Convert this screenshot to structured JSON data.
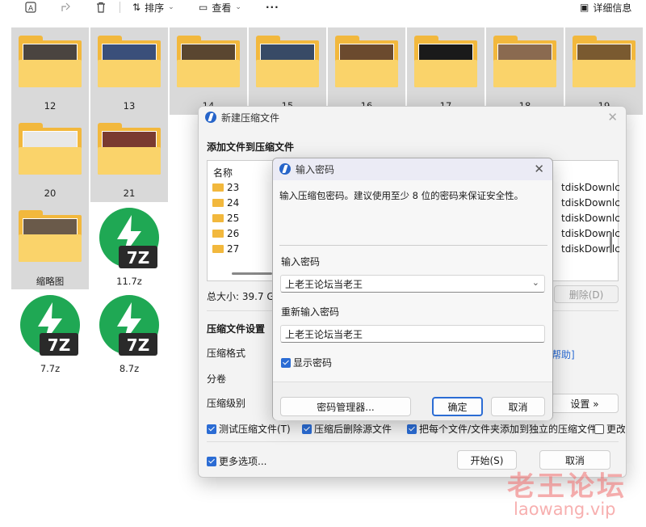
{
  "toolbar": {
    "sort_label": "排序",
    "view_label": "查看",
    "more_label": "···",
    "details_label": "详细信息"
  },
  "files": [
    {
      "label": "12",
      "kind": "folder",
      "photo": "#4a4440"
    },
    {
      "label": "13",
      "kind": "folder",
      "photo": "#3a4f7a"
    },
    {
      "label": "14",
      "kind": "folder",
      "photo": "#5a4630"
    },
    {
      "label": "15",
      "kind": "folder",
      "photo": "#384a66"
    },
    {
      "label": "16",
      "kind": "folder",
      "photo": "#6b4a2e"
    },
    {
      "label": "17",
      "kind": "folder",
      "photo": "#1a1a1a"
    },
    {
      "label": "18",
      "kind": "folder",
      "photo": "#8a6a50"
    },
    {
      "label": "19",
      "kind": "folder",
      "photo": "#7a5a30"
    },
    {
      "label": "20",
      "kind": "folder",
      "photo": "#e8e8e8"
    },
    {
      "label": "21",
      "kind": "folder",
      "photo": "#7a3a30"
    },
    {
      "label": "缩略图",
      "kind": "folder",
      "photo": "#6a5a4a"
    },
    {
      "label": "11.7z",
      "kind": "7z"
    },
    {
      "label": "7.7z",
      "kind": "7z"
    },
    {
      "label": "8.7z",
      "kind": "7z"
    }
  ],
  "compress_dialog": {
    "title": "新建压缩文件",
    "add_files_heading": "添加文件到压缩文件",
    "list_header": "名称",
    "list_items": [
      "23",
      "24",
      "25",
      "26",
      "27"
    ],
    "right_items": [
      "tdiskDownlc",
      "tdiskDownlc",
      "tdiskDownlc",
      "tdiskDownlc",
      "tdiskDownlc"
    ],
    "total_size": "总大小: 39.7 GB",
    "delete_button": "删除(D)",
    "settings_heading": "压缩文件设置",
    "format_label": "压缩格式",
    "split_label": "分卷",
    "level_label": "压缩级别",
    "help_link": "帮助]",
    "settings_button": "设置 »",
    "opt_test": "测试压缩文件(T)",
    "opt_delete_after": "压缩后删除源文件",
    "opt_separate": "把每个文件/文件夹添加到独立的压缩文件",
    "opt_more_cut": "更改",
    "more_options": "更多选项...",
    "start_button": "开始(S)",
    "cancel_button": "取消"
  },
  "password_dialog": {
    "title": "输入密码",
    "description": "输入压缩包密码。建议使用至少 8 位的密码来保证安全性。",
    "enter_label": "输入密码",
    "password_value": "上老王论坛当老王",
    "reenter_label": "重新输入密码",
    "reenter_value": "上老王论坛当老王",
    "show_password": "显示密码",
    "manager_button": "密码管理器...",
    "ok_button": "确定",
    "cancel_button": "取消"
  },
  "watermark": {
    "chinese": "老王论坛",
    "url": "laowang.vip"
  },
  "colors": {
    "accent": "#2b6cd4",
    "folder": "#f2b83d",
    "zip_green": "#1fa854"
  }
}
